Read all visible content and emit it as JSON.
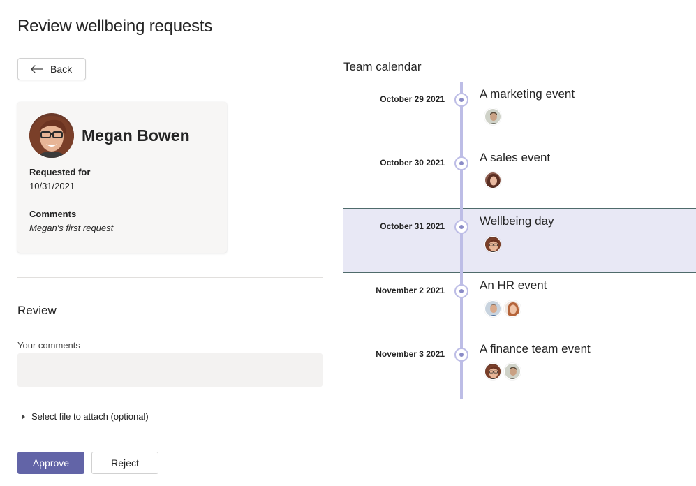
{
  "page": {
    "title": "Review wellbeing requests"
  },
  "back_button": {
    "label": "Back",
    "icon": "arrow-left-icon"
  },
  "request": {
    "name": "Megan Bowen",
    "requested_for_label": "Requested for",
    "requested_for_value": "10/31/2021",
    "comments_label": "Comments",
    "comments_value": "Megan's first request"
  },
  "review": {
    "title": "Review",
    "your_comments_label": "Your comments",
    "your_comments_value": "",
    "attach_label": "Select file to attach (optional)",
    "approve_label": "Approve",
    "reject_label": "Reject"
  },
  "calendar": {
    "title": "Team calendar",
    "events": [
      {
        "date": "October 29 2021",
        "title": "A marketing event",
        "attendees": [
          "man-glasses"
        ],
        "selected": false
      },
      {
        "date": "October 30 2021",
        "title": "A sales event",
        "attendees": [
          "woman-dark-hair"
        ],
        "selected": false
      },
      {
        "date": "October 31 2021",
        "title": "Wellbeing day",
        "attendees": [
          "megan"
        ],
        "selected": true
      },
      {
        "date": "November 2 2021",
        "title": "An HR event",
        "attendees": [
          "man-blue",
          "woman-auburn"
        ],
        "selected": false
      },
      {
        "date": "November 3 2021",
        "title": "A finance team event",
        "attendees": [
          "megan",
          "man-glasses"
        ],
        "selected": false
      }
    ]
  },
  "colors": {
    "accent": "#6264a7",
    "timeline": "#bdbde6",
    "highlight": "#e8e8f5"
  }
}
